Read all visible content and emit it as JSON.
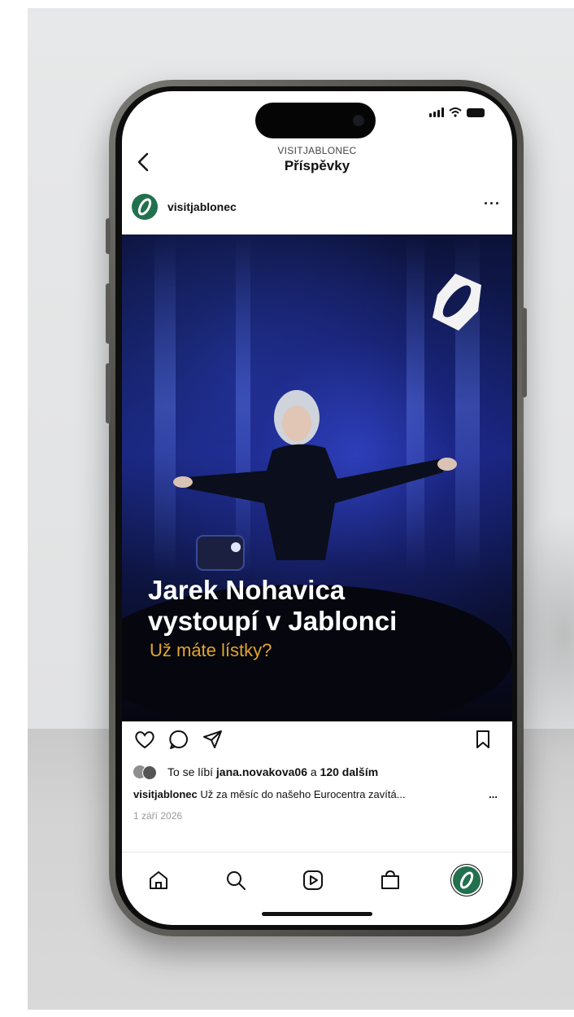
{
  "header": {
    "account_name": "VISITJABLONEC",
    "title": "Příspěvky"
  },
  "post": {
    "username": "visitjablonec",
    "more_label": "···",
    "headline_line1": "Jarek Nohavica",
    "headline_line2": "vystoupí v Jablonci",
    "subline": "Už máte lístky?",
    "likes_prefix": "To se líbí",
    "likes_user": "jana.novakova06",
    "likes_connector": "a",
    "likes_others": "120 dalším",
    "caption_user": "visitjablonec",
    "caption_text": "Už za měsíc do našeho Eurocentra zavítá...",
    "caption_more": "...",
    "date": "1 září 2026"
  },
  "colors": {
    "brand_green": "#23704f",
    "accent_gold": "#e3a52a",
    "stage_blue": "#18247a"
  },
  "icons": {
    "back": "chevron-left-icon",
    "like": "heart-icon",
    "comment": "comment-icon",
    "share": "send-icon",
    "save": "bookmark-icon",
    "tabs": [
      "home-icon",
      "search-icon",
      "reels-icon",
      "shop-icon",
      "profile-icon"
    ]
  }
}
